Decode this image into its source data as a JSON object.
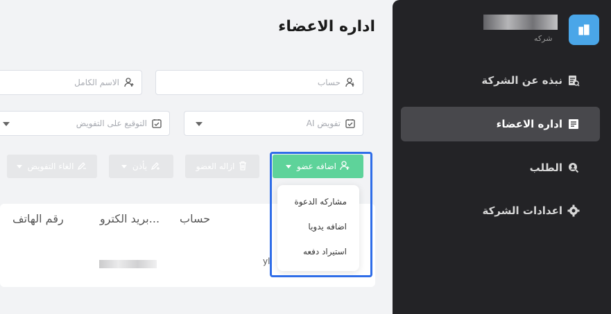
{
  "page": {
    "title": "اداره الاعضاء"
  },
  "filters": {
    "account_placeholder": "حساب",
    "fullname_placeholder": "الاسم الكامل",
    "ai_auth_placeholder": "تفويض AI",
    "sign_auth_placeholder": "التوقيع على التفويض"
  },
  "toolbar": {
    "add_member": "اضافه عضو",
    "remove_member": "ازاله العضو",
    "allow": "يأذن",
    "cancel_auth": "الغاء التفويض"
  },
  "add_menu": {
    "items": [
      "مشاركه الدعوة",
      "اضافه يدويا",
      "استيراد دفعه"
    ]
  },
  "table": {
    "headers": [
      "حساب",
      "بريد الكترو...",
      "رقم الهاتف"
    ],
    "row_partial": "yli"
  },
  "sidebar": {
    "company_label": "شركه",
    "items": [
      {
        "label": "نبذه عن الشركة",
        "icon": "company-info-icon"
      },
      {
        "label": "اداره الاعضاء",
        "icon": "members-icon",
        "active": true
      },
      {
        "label": "الطلب",
        "icon": "request-icon"
      },
      {
        "label": "اعدادات الشركة",
        "icon": "gear-icon"
      }
    ]
  },
  "colors": {
    "primary": "#5ed39a",
    "highlight": "#2f6de8",
    "arrow": "#2f86f0",
    "sidebar_bg": "#232326",
    "sidebar_active": "#48484c",
    "logo_bg": "#4aa6e8"
  }
}
